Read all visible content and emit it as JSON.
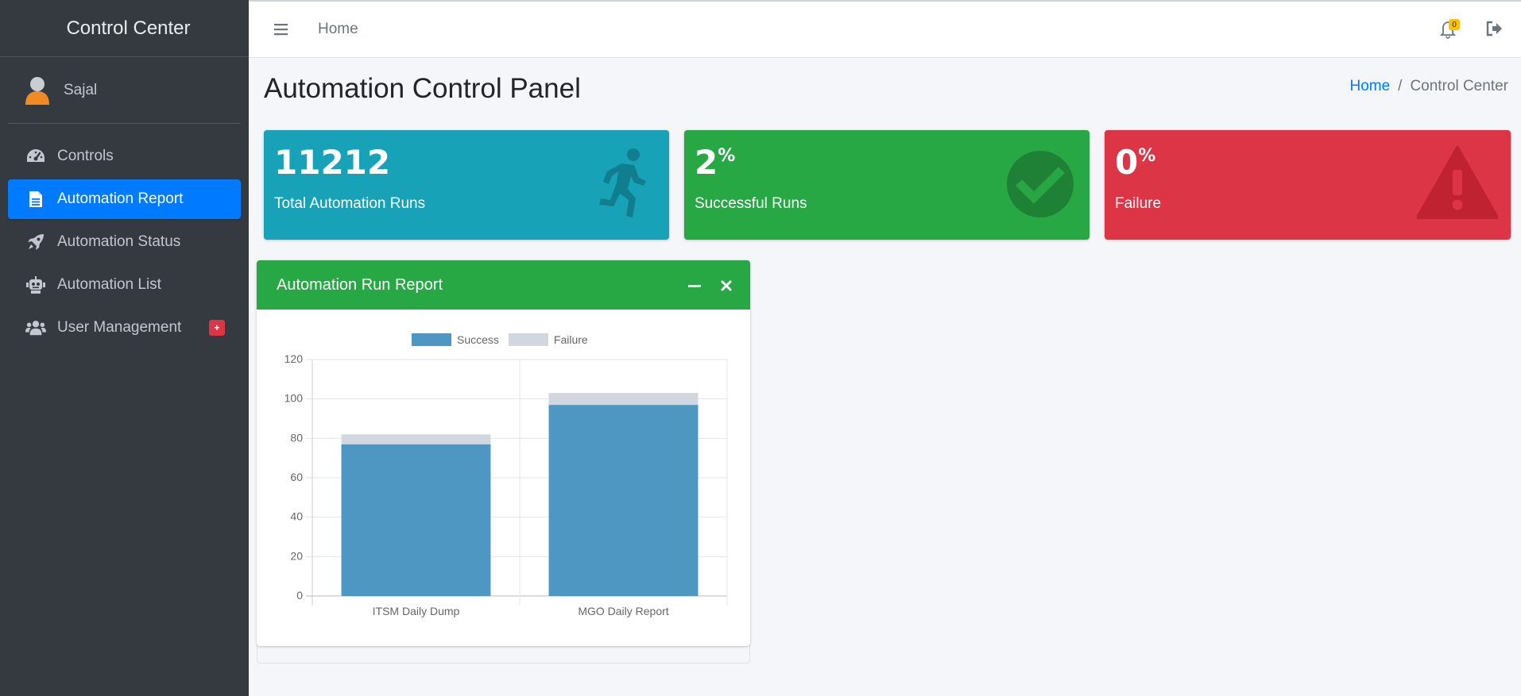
{
  "sidebar": {
    "brand": "Control Center",
    "user_name": "Sajal",
    "items": [
      {
        "label": "Controls",
        "icon": "tachometer-icon"
      },
      {
        "label": "Automation Report",
        "icon": "file-icon",
        "active": true
      },
      {
        "label": "Automation Status",
        "icon": "rocket-icon"
      },
      {
        "label": "Automation List",
        "icon": "robot-icon"
      },
      {
        "label": "User Management",
        "icon": "users-icon",
        "badge": "+"
      }
    ]
  },
  "topbar": {
    "home_link": "Home",
    "notification_count": "0"
  },
  "page": {
    "title": "Automation Control Panel",
    "breadcrumb": {
      "home": "Home",
      "current": "Control Center"
    }
  },
  "stats": {
    "total": {
      "value": "11212",
      "label": "Total Automation Runs",
      "color": "#17a2b8",
      "icon": "running-icon"
    },
    "success": {
      "value": "2",
      "suffix": "%",
      "label": "Successful Runs",
      "color": "#28a745",
      "icon": "check-circle-icon"
    },
    "failure": {
      "value": "0",
      "suffix": "%",
      "label": "Failure",
      "color": "#dc3545",
      "icon": "warning-icon"
    }
  },
  "report_card": {
    "title": "Automation Run Report",
    "header_color": "#28a745"
  },
  "chart_data": {
    "type": "bar",
    "stacked": true,
    "categories": [
      "ITSM Daily Dump",
      "MGO Daily Report"
    ],
    "series": [
      {
        "name": "Success",
        "values": [
          77,
          97
        ],
        "color": "#4f97c3"
      },
      {
        "name": "Failure",
        "values": [
          5,
          6
        ],
        "color": "#d2d6de"
      }
    ],
    "yticks": [
      0,
      20,
      40,
      60,
      80,
      100,
      120
    ],
    "ylim": [
      0,
      120
    ],
    "grid": true,
    "legend_position": "top"
  }
}
